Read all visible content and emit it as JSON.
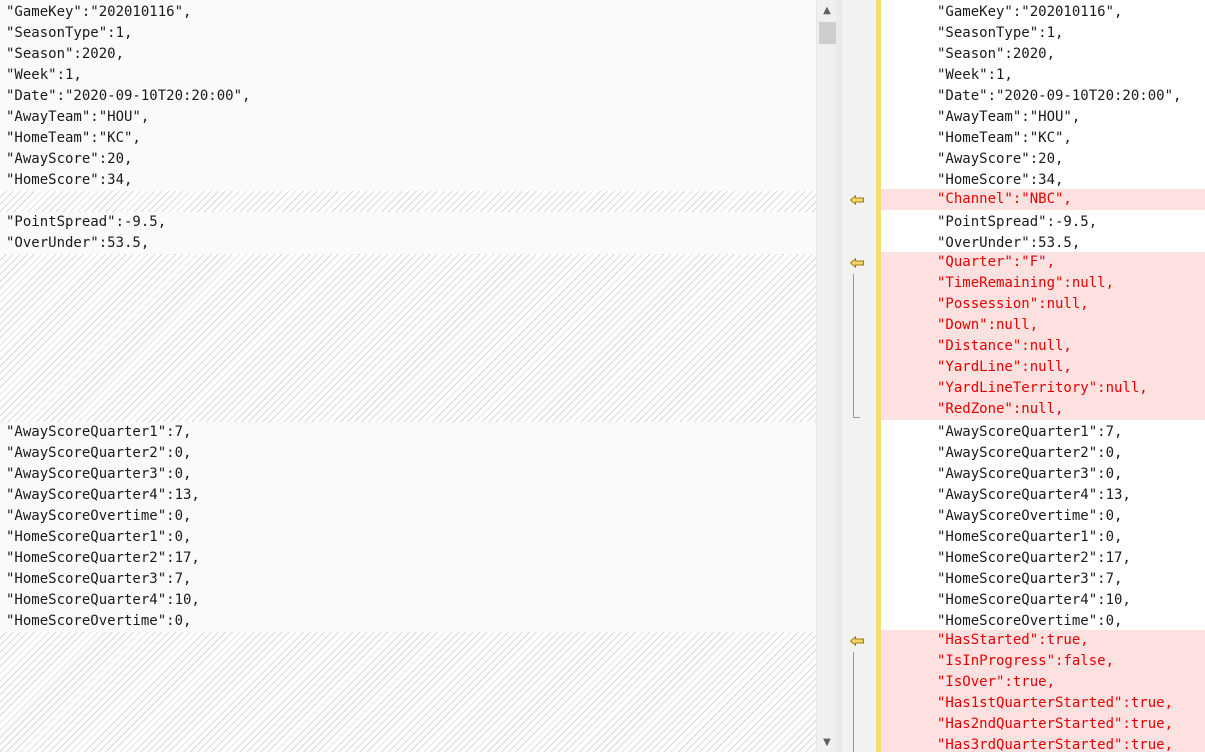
{
  "left_pane": {
    "lines_top": [
      "\"GameKey\":\"202010116\",",
      "\"SeasonType\":1,",
      "\"Season\":2020,",
      "\"Week\":1,",
      "\"Date\":\"2020-09-10T20:20:00\",",
      "\"AwayTeam\":\"HOU\",",
      "\"HomeTeam\":\"KC\",",
      "\"AwayScore\":20,",
      "\"HomeScore\":34,"
    ],
    "lines_mid1": [
      "\"PointSpread\":-9.5,",
      "\"OverUnder\":53.5,"
    ],
    "lines_mid2": [
      "\"AwayScoreQuarter1\":7,",
      "\"AwayScoreQuarter2\":0,",
      "\"AwayScoreQuarter3\":0,",
      "\"AwayScoreQuarter4\":13,",
      "\"AwayScoreOvertime\":0,",
      "\"HomeScoreQuarter1\":0,",
      "\"HomeScoreQuarter2\":17,",
      "\"HomeScoreQuarter3\":7,",
      "\"HomeScoreQuarter4\":10,",
      "\"HomeScoreOvertime\":0,"
    ]
  },
  "right_pane": {
    "lines": [
      {
        "text": "\"GameKey\":\"202010116\",",
        "added": false
      },
      {
        "text": "\"SeasonType\":1,",
        "added": false
      },
      {
        "text": "\"Season\":2020,",
        "added": false
      },
      {
        "text": "\"Week\":1,",
        "added": false
      },
      {
        "text": "\"Date\":\"2020-09-10T20:20:00\",",
        "added": false
      },
      {
        "text": "\"AwayTeam\":\"HOU\",",
        "added": false
      },
      {
        "text": "\"HomeTeam\":\"KC\",",
        "added": false
      },
      {
        "text": "\"AwayScore\":20,",
        "added": false
      },
      {
        "text": "\"HomeScore\":34,",
        "added": false
      },
      {
        "text": "\"Channel\":\"NBC\",",
        "added": true
      },
      {
        "text": "\"PointSpread\":-9.5,",
        "added": false
      },
      {
        "text": "\"OverUnder\":53.5,",
        "added": false
      },
      {
        "text": "\"Quarter\":\"F\",",
        "added": true
      },
      {
        "text": "\"TimeRemaining\":null,",
        "added": true
      },
      {
        "text": "\"Possession\":null,",
        "added": true
      },
      {
        "text": "\"Down\":null,",
        "added": true
      },
      {
        "text": "\"Distance\":null,",
        "added": true
      },
      {
        "text": "\"YardLine\":null,",
        "added": true
      },
      {
        "text": "\"YardLineTerritory\":null,",
        "added": true
      },
      {
        "text": "\"RedZone\":null,",
        "added": true
      },
      {
        "text": "\"AwayScoreQuarter1\":7,",
        "added": false
      },
      {
        "text": "\"AwayScoreQuarter2\":0,",
        "added": false
      },
      {
        "text": "\"AwayScoreQuarter3\":0,",
        "added": false
      },
      {
        "text": "\"AwayScoreQuarter4\":13,",
        "added": false
      },
      {
        "text": "\"AwayScoreOvertime\":0,",
        "added": false
      },
      {
        "text": "\"HomeScoreQuarter1\":0,",
        "added": false
      },
      {
        "text": "\"HomeScoreQuarter2\":17,",
        "added": false
      },
      {
        "text": "\"HomeScoreQuarter3\":7,",
        "added": false
      },
      {
        "text": "\"HomeScoreQuarter4\":10,",
        "added": false
      },
      {
        "text": "\"HomeScoreOvertime\":0,",
        "added": false
      },
      {
        "text": "\"HasStarted\":true,",
        "added": true
      },
      {
        "text": "\"IsInProgress\":false,",
        "added": true
      },
      {
        "text": "\"IsOver\":true,",
        "added": true
      },
      {
        "text": "\"Has1stQuarterStarted\":true,",
        "added": true
      },
      {
        "text": "\"Has2ndQuarterStarted\":true,",
        "added": true
      },
      {
        "text": "\"Has3rdQuarterStarted\":true,",
        "added": true
      }
    ]
  },
  "colors": {
    "added_text": "#e60000",
    "added_bg": "#fde1e1",
    "change_marker": "#f7dc6f"
  },
  "icons": {
    "scroll_up": "chevron-up-icon",
    "scroll_down": "chevron-down-icon",
    "copy_left": "arrow-left-icon"
  }
}
